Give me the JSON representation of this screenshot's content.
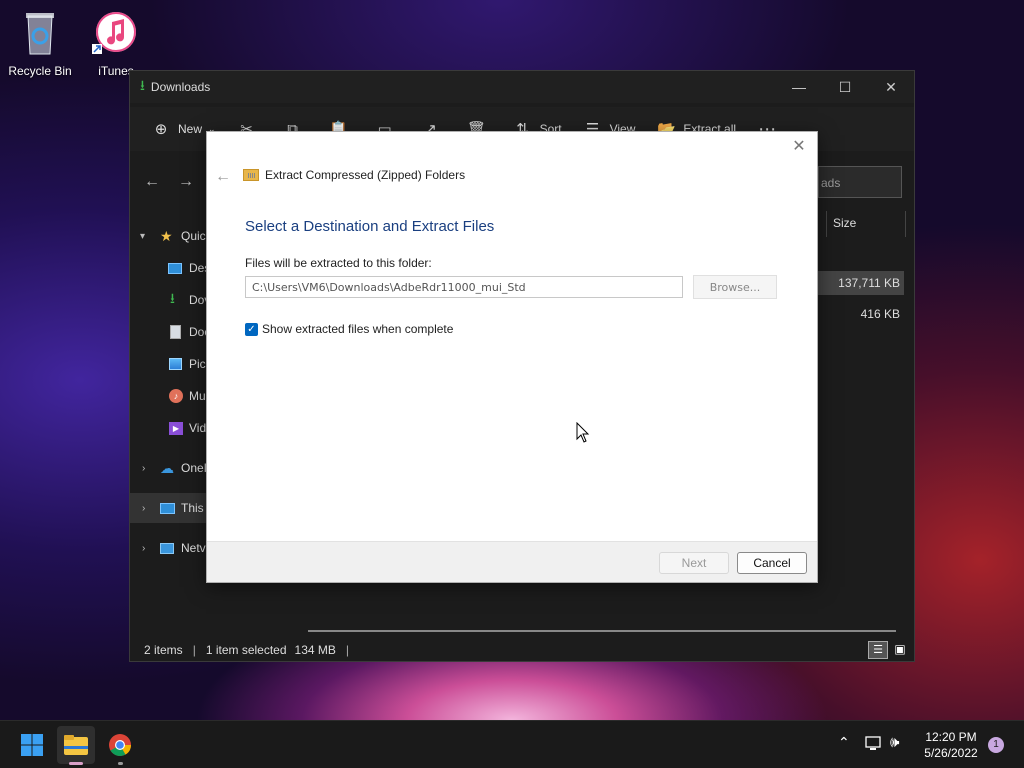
{
  "desktop": {
    "icons": [
      {
        "label": "Recycle Bin",
        "icon": "recycle-bin-icon"
      },
      {
        "label": "iTunes",
        "icon": "itunes-icon"
      }
    ]
  },
  "explorer": {
    "title": "Downloads",
    "toolbar": {
      "new_label": "New",
      "sort_label": "Sort",
      "view_label": "View",
      "extract_all_label": "Extract all"
    },
    "search_placeholder": "ads",
    "column_size": "Size",
    "sizes": [
      "137,711 KB",
      "416 KB"
    ],
    "nav_items": [
      {
        "label": "Quic",
        "icon": "star-icon"
      },
      {
        "label": "Des",
        "icon": "desktop-icon"
      },
      {
        "label": "Dov",
        "icon": "download-icon"
      },
      {
        "label": "Doc",
        "icon": "document-icon"
      },
      {
        "label": "Pic",
        "icon": "pictures-icon"
      },
      {
        "label": "Mu",
        "icon": "music-icon"
      },
      {
        "label": "Vid",
        "icon": "video-icon"
      },
      {
        "label": "OneI",
        "icon": "cloud-icon"
      },
      {
        "label": "This",
        "icon": "this-pc-icon"
      },
      {
        "label": "Netv",
        "icon": "network-icon"
      }
    ],
    "status": {
      "items": "2 items",
      "selected": "1 item selected",
      "size": "134 MB"
    }
  },
  "dialog": {
    "title": "Extract Compressed (Zipped) Folders",
    "heading": "Select a Destination and Extract Files",
    "path_label": "Files will be extracted to this folder:",
    "path_value": "C:\\Users\\VM6\\Downloads\\AdbeRdr11000_mui_Std",
    "browse_label": "Browse...",
    "checkbox_label": "Show extracted files when complete",
    "checkbox_checked": true,
    "next_label": "Next",
    "cancel_label": "Cancel"
  },
  "taskbar": {
    "time": "12:20 PM",
    "date": "5/26/2022",
    "notification_count": "1"
  },
  "colors": {
    "accent": "#0067c0",
    "dialog_heading": "#1a3f80"
  }
}
